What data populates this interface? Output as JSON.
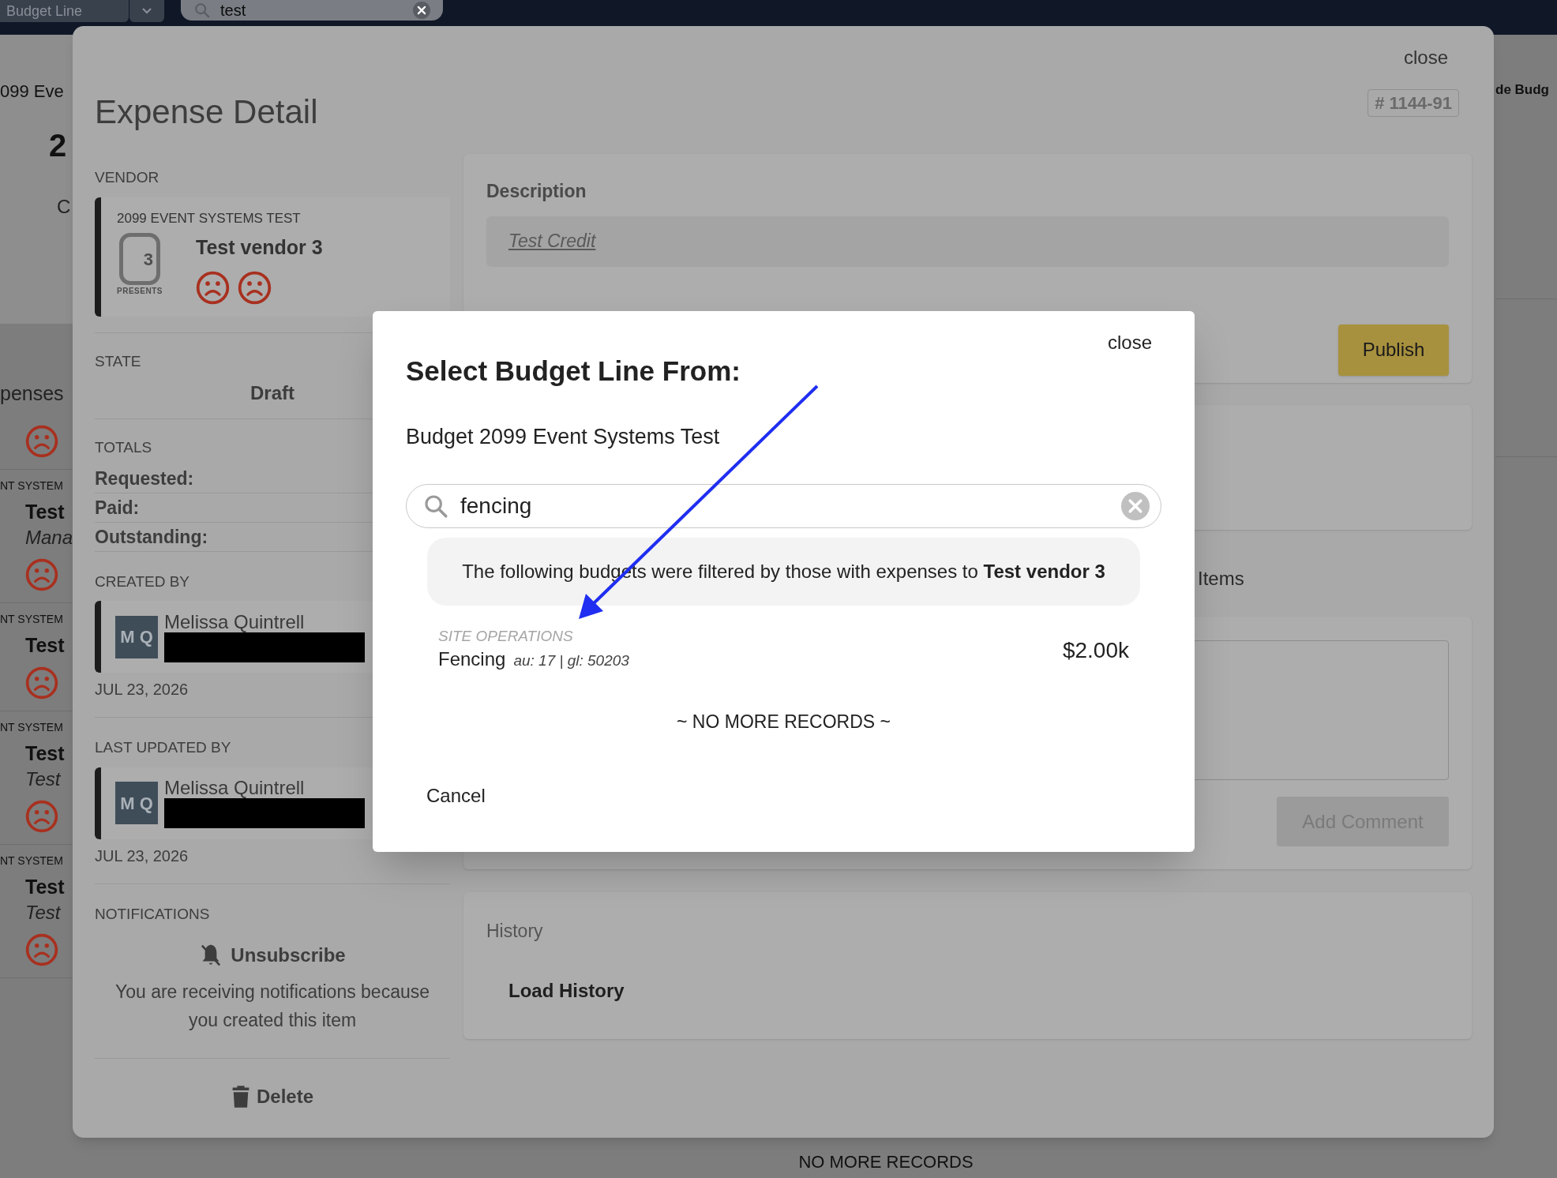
{
  "top_bar": {
    "dropdown": {
      "label": "Budget Line"
    },
    "search": {
      "value": "test"
    }
  },
  "background": {
    "header_left": "099 Eve",
    "header_right": "de Budg",
    "total": "2",
    "caption": "C",
    "section": "penses",
    "list": [
      {
        "group": "NT SYSTEM",
        "name": "Test",
        "note": "Mana"
      },
      {
        "group": "NT SYSTEM",
        "name": "Test"
      },
      {
        "group": "NT SYSTEM",
        "name": "Test",
        "note": "Test"
      },
      {
        "group": "NT SYSTEM",
        "name": "Test",
        "note": "Test"
      }
    ],
    "footer": "NO MORE RECORDS"
  },
  "expense": {
    "close": "close",
    "title": "Expense Detail",
    "number": "# 1144-91",
    "vendor": {
      "label": "VENDOR",
      "budget": "2099 EVENT SYSTEMS TEST",
      "name": "Test vendor 3",
      "logo_mark": "3",
      "logo_caption": "PRESENTS"
    },
    "state": {
      "label": "STATE",
      "value": "Draft"
    },
    "totals": {
      "label": "TOTALS",
      "rows": [
        "Requested:",
        "Paid:",
        "Outstanding:"
      ]
    },
    "people": [
      {
        "label": "CREATED BY",
        "initials": "M Q",
        "name": "Melissa Quintrell",
        "date": "JUL 23, 2026"
      },
      {
        "label": "LAST UPDATED BY",
        "initials": "M Q",
        "name": "Melissa Quintrell",
        "date": "JUL 23, 2026"
      }
    ],
    "notifications": {
      "label": "NOTIFICATIONS",
      "action": "Unsubscribe",
      "note": "You are receiving notifications because you created this item"
    },
    "delete": "Delete",
    "description": {
      "label": "Description",
      "value": "Test Credit"
    },
    "publish": "Publish",
    "items_label": "Items",
    "comment": {
      "button": "Add Comment",
      "disabled": true
    },
    "history": {
      "label": "History",
      "button": "Load History"
    }
  },
  "modal": {
    "close": "close",
    "title": "Select Budget Line From:",
    "budget": "Budget 2099 Event Systems Test",
    "search": {
      "value": "fencing"
    },
    "notice": "The following budgets were filtered by those with expenses to **Test vendor 3**",
    "lines": [
      {
        "group": "SITE OPERATIONS",
        "name": "Fencing",
        "codes": "au: 17 | gl: 50203",
        "amount": "$2.00k"
      }
    ],
    "end": "~ NO MORE RECORDS ~",
    "cancel": "Cancel"
  }
}
